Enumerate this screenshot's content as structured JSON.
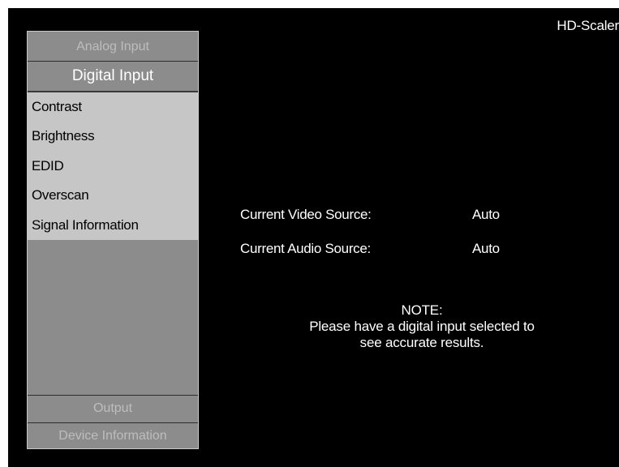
{
  "header": {
    "brand": "HD-Scaler"
  },
  "menu": {
    "analog_input": "Analog Input",
    "digital_input": "Digital Input",
    "digital_items": [
      {
        "label": "Contrast"
      },
      {
        "label": "Brightness"
      },
      {
        "label": "EDID"
      },
      {
        "label": "Overscan"
      },
      {
        "label": "Signal Information"
      }
    ],
    "output": "Output",
    "device_information": "Device Information"
  },
  "info": {
    "video_label": "Current Video Source:",
    "video_value": "Auto",
    "audio_label": "Current Audio Source:",
    "audio_value": "Auto"
  },
  "note": {
    "title": "NOTE:",
    "line1": "Please have a digital input selected to",
    "line2": "see accurate results."
  },
  "colors": {
    "background": "#000000",
    "menu_panel": "#8c8c8c",
    "submenu_panel": "#c6c6c6",
    "inactive_text": "#bdbdbd"
  }
}
